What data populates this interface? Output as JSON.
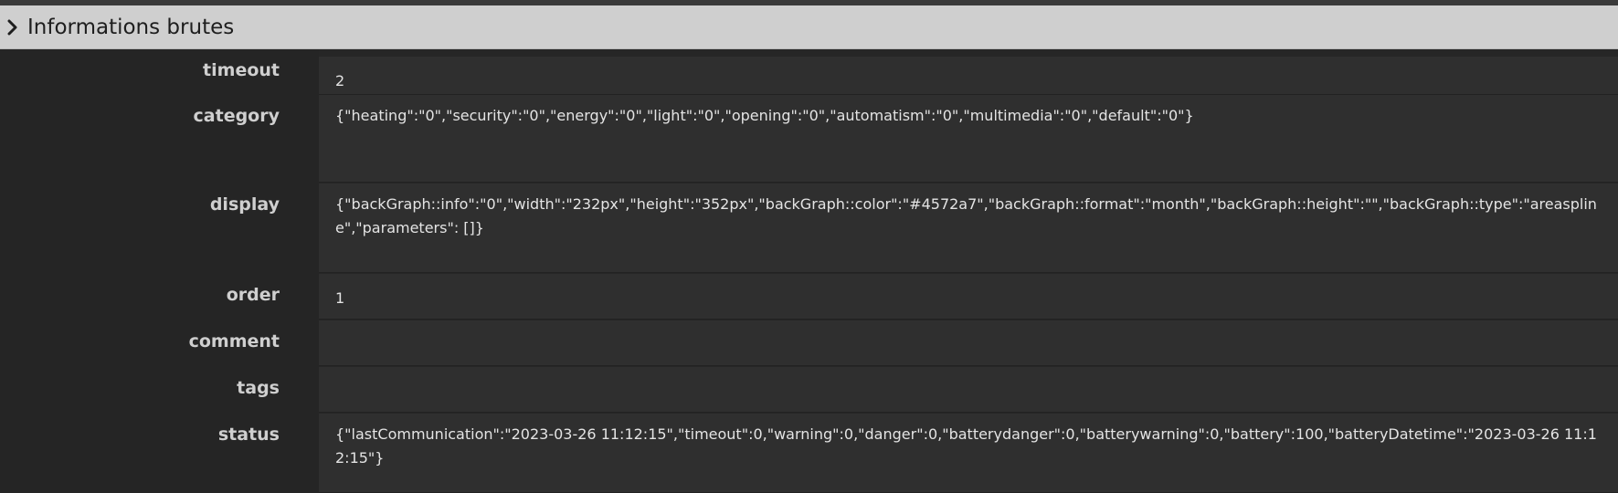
{
  "panel": {
    "title": "Informations brutes",
    "icon": "chevron-right-icon"
  },
  "rows": [
    {
      "label": "timeout",
      "value": "2"
    },
    {
      "label": "category",
      "value": "{\"heating\":\"0\",\"security\":\"0\",\"energy\":\"0\",\"light\":\"0\",\"opening\":\"0\",\"automatism\":\"0\",\"multimedia\":\"0\",\"default\":\"0\"}"
    },
    {
      "label": "display",
      "value": "{\"backGraph::info\":\"0\",\"width\":\"232px\",\"height\":\"352px\",\"backGraph::color\":\"#4572a7\",\"backGraph::format\":\"month\",\"backGraph::height\":\"\",\"backGraph::type\":\"areaspline\",\"parameters\": []}"
    },
    {
      "label": "order",
      "value": "1"
    },
    {
      "label": "comment",
      "value": ""
    },
    {
      "label": "tags",
      "value": ""
    },
    {
      "label": "status",
      "value": "{\"lastCommunication\":\"2023-03-26 11:12:15\",\"timeout\":0,\"warning\":0,\"danger\":0,\"batterydanger\":0,\"batterywarning\":0,\"battery\":100,\"batteryDatetime\":\"2023-03-26 11:12:15\"}"
    }
  ],
  "colors": {
    "header_bg": "#cfcfcf",
    "body_bg": "#262626",
    "value_bg": "#2f2f2f",
    "label_text": "#cfcfcf",
    "value_text": "#e4e4e4"
  }
}
